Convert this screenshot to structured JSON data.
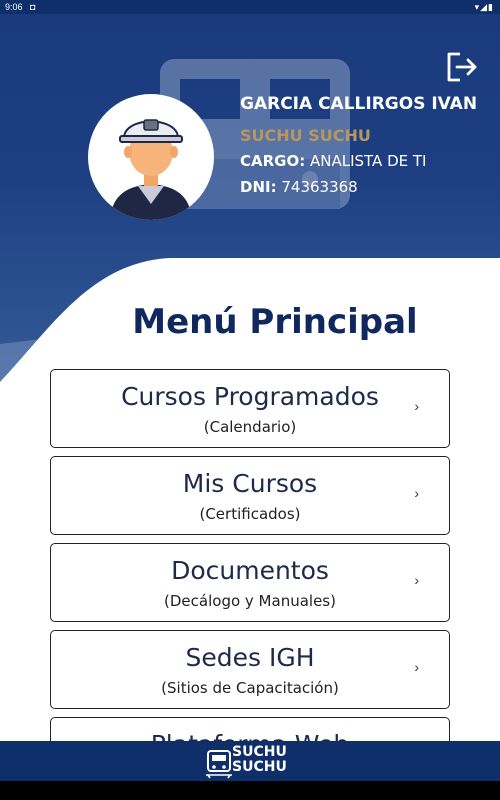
{
  "status_bar": {
    "time": "9:06"
  },
  "user": {
    "name": "GARCIA CALLIRGOS IVAN",
    "company": "SUCHU SUCHU",
    "cargo_label": "CARGO:",
    "cargo_value": "ANALISTA DE TI",
    "dni_label": "DNI:",
    "dni_value": "74363368"
  },
  "menu": {
    "title": "Menú Principal",
    "items": [
      {
        "title": "Cursos Programados",
        "subtitle": "(Calendario)",
        "chevron": "›"
      },
      {
        "title": "Mis Cursos",
        "subtitle": "(Certificados)",
        "chevron": "›"
      },
      {
        "title": "Documentos",
        "subtitle": "(Decálogo y Manuales)",
        "chevron": "›"
      },
      {
        "title": "Sedes IGH",
        "subtitle": "(Sitios de Capacitación)",
        "chevron": "›"
      },
      {
        "title": "Plataforma Web",
        "subtitle": "",
        "chevron": "›"
      }
    ]
  },
  "footer": {
    "logo_line1": "SUCHU",
    "logo_line2": "SUCHU"
  },
  "colors": {
    "primary": "#0f2f6b",
    "accent": "#b8975e",
    "title": "#10285e"
  },
  "icons": {
    "logout": "logout-icon",
    "avatar": "miner-avatar-icon",
    "logo": "train-logo-icon"
  }
}
